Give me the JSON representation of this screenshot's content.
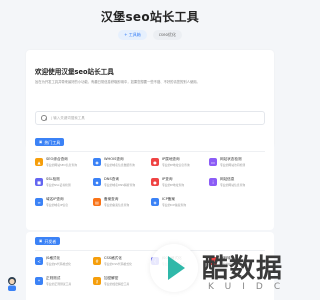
{
  "header": {
    "title": "汉堡seo站长工具",
    "links": [
      {
        "label": "+ 工具箱"
      },
      {
        "label": "cseo优化"
      }
    ]
  },
  "welcome": {
    "heading": "欢迎使用汉堡seo站长工具",
    "description": "旨在为开发工具并带来最好的小功能，有趣日常信息获取即用中，如果您想要一些不错、不好的请您的别人使用。"
  },
  "search": {
    "placeholder": "| 输入关键词搜索工具"
  },
  "hot_section": {
    "title": "热门工具",
    "tools": [
      {
        "name": "SEO综合查询",
        "desc": "专业的网站SEO信息查询",
        "icon": "chart-icon",
        "color": "#f59e0b"
      },
      {
        "name": "WHOIS查询",
        "desc": "专业的域名信息数据查询",
        "icon": "globe-icon",
        "color": "#3b82f6"
      },
      {
        "name": "IP属地查询",
        "desc": "专业的IP地址信息查询",
        "icon": "pin-icon",
        "color": "#ef4444"
      },
      {
        "name": "网站状态检测",
        "desc": "专业的网站访问检测",
        "icon": "monitor-icon",
        "color": "#8b5cf6"
      },
      {
        "name": "SSL检测",
        "desc": "专业的SSL证书检测",
        "icon": "lock-icon",
        "color": "#6366f1"
      },
      {
        "name": "DNS查询",
        "desc": "专业的域名DNS解析查询",
        "icon": "dns-icon",
        "color": "#3b82f6"
      },
      {
        "name": "IP查询",
        "desc": "专业的IP地址查询",
        "icon": "ip-icon",
        "color": "#ef4444"
      },
      {
        "name": "网站信息",
        "desc": "专业的网站信息查询",
        "icon": "info-icon",
        "color": "#8b5cf6"
      },
      {
        "name": "域名IP查询",
        "desc": "专业的域名IP信息",
        "icon": "link-icon",
        "color": "#3b82f6"
      },
      {
        "name": "备案查询",
        "desc": "专业的备案信息查询",
        "icon": "doc-icon",
        "color": "#f97316"
      },
      {
        "name": "ICP备案",
        "desc": "专业的ICP备案查询",
        "icon": "shield-icon",
        "color": "#3b82f6"
      }
    ]
  },
  "dev_section": {
    "title": "开发者",
    "tools": [
      {
        "name": "JS格式化",
        "desc": "专业的JS代码格式化",
        "icon": "code-icon",
        "color": "#3b82f6"
      },
      {
        "name": "CSS格式化",
        "desc": "专业的CSS代码格式化",
        "icon": "css-icon",
        "color": "#f59e0b"
      },
      {
        "name": "JSON格式化",
        "desc": "专业的JSON格式化",
        "icon": "json-icon",
        "color": "#6366f1"
      },
      {
        "name": "编码转换",
        "desc": "专业的编码转换工具",
        "icon": "convert-icon",
        "color": "#ef4444"
      },
      {
        "name": "正则测试",
        "desc": "专业的正则测试工具",
        "icon": "regex-icon",
        "color": "#3b82f6"
      },
      {
        "name": "加密解密",
        "desc": "专业的加密解密工具",
        "icon": "key-icon",
        "color": "#f59e0b"
      }
    ]
  },
  "watermark": {
    "title": "酷数据",
    "subtitle": "KUIDC"
  }
}
